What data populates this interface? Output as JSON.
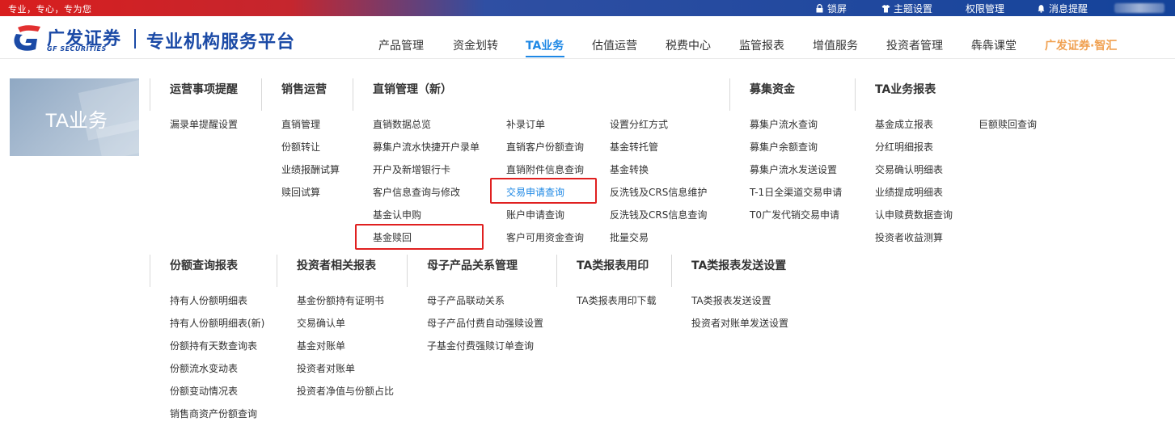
{
  "topbar": {
    "slogan": "专业，专心，专为您",
    "actions": [
      "锁屏",
      "主题设置",
      "权限管理",
      "消息提醒"
    ]
  },
  "header": {
    "logo_cn": "广发证券",
    "logo_en": "GF SECURITIES",
    "platform_title": "专业机构服务平台",
    "nav": [
      "产品管理",
      "资金划转",
      "TA业务",
      "估值运营",
      "税费中心",
      "监管报表",
      "增值服务",
      "投资者管理",
      "犇犇课堂",
      "广发证券·智汇"
    ],
    "active_nav": "TA业务"
  },
  "banner": {
    "title": "TA业务"
  },
  "menu": {
    "group1": {
      "ops_reminder": {
        "title": "运营事项提醒",
        "items": [
          "漏录单提醒设置"
        ]
      },
      "sales_ops": {
        "title": "销售运营",
        "items": [
          "直销管理",
          "份额转让",
          "业绩报酬试算",
          "赎回试算"
        ]
      },
      "direct_sales": {
        "title": "直销管理（新）",
        "col1": [
          "直销数据总览",
          "募集户流水快捷开户录单",
          "开户及新增银行卡",
          "客户信息查询与修改",
          "基金认申购",
          "基金赎回"
        ],
        "col2": [
          "补录订单",
          "直销客户份额查询",
          "直销附件信息查询",
          "交易申请查询",
          "账户申请查询",
          "客户可用资金查询"
        ],
        "col3": [
          "设置分红方式",
          "基金转托管",
          "基金转换",
          "反洗钱及CRS信息维护",
          "反洗钱及CRS信息查询",
          "批量交易"
        ]
      },
      "fundraising": {
        "title": "募集资金",
        "items": [
          "募集户流水查询",
          "募集户余额查询",
          "募集户流水发送设置",
          "T-1日全渠道交易申请",
          "T0广发代销交易申请"
        ]
      },
      "ta_reports": {
        "title": "TA业务报表",
        "col1": [
          "基金成立报表",
          "分红明细报表",
          "交易确认明细表",
          "业绩提成明细表",
          "认申赎费数据查询",
          "投资者收益测算"
        ],
        "col2": [
          "巨额赎回查询"
        ]
      }
    },
    "group2": {
      "share_reports": {
        "title": "份额查询报表",
        "items": [
          "持有人份额明细表",
          "持有人份额明细表(新)",
          "份额持有天数查询表",
          "份额流水变动表",
          "份额变动情况表",
          "销售商资产份额查询"
        ]
      },
      "investor_reports": {
        "title": "投资者相关报表",
        "items": [
          "基金份额持有证明书",
          "交易确认单",
          "基金对账单",
          "投资者对账单",
          "投资者净值与份额占比"
        ]
      },
      "parent_child": {
        "title": "母子产品关系管理",
        "items": [
          "母子产品联动关系",
          "母子产品付费自动强赎设置",
          "子基金付费强赎订单查询"
        ]
      },
      "ta_print": {
        "title": "TA类报表用印",
        "items": [
          "TA类报表用印下载"
        ]
      },
      "ta_send": {
        "title": "TA类报表发送设置",
        "items": [
          "TA类报表发送设置",
          "投资者对账单发送设置"
        ]
      }
    },
    "active_item": "交易申请查询"
  },
  "colors": {
    "brand_blue": "#1b4aa6",
    "active_blue": "#1e88e5",
    "highlight_red": "#e02020",
    "topbar_red": "#d81e1e"
  }
}
